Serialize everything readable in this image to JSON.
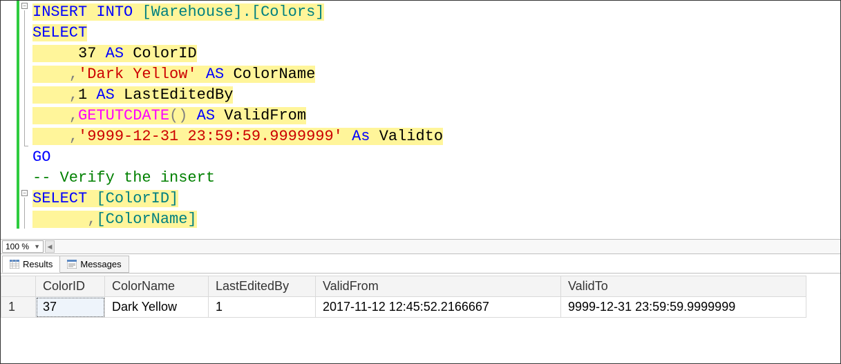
{
  "code": {
    "line1": {
      "insert_into": "INSERT INTO",
      "tbl": "[Warehouse].[Colors]"
    },
    "line2": {
      "select": "SELECT"
    },
    "line3": {
      "val": "37",
      "as": "AS",
      "alias": "ColorID"
    },
    "line4": {
      "comma": ",",
      "val": "'Dark Yellow'",
      "as": "AS",
      "alias": "ColorName"
    },
    "line5": {
      "comma": ",",
      "val": "1",
      "as": "AS",
      "alias": "LastEditedBy"
    },
    "line6": {
      "comma": ",",
      "func": "GETUTCDATE",
      "parens": "()",
      "as": "AS",
      "alias": "ValidFrom"
    },
    "line7": {
      "comma": ",",
      "val": "'9999-12-31 23:59:59.9999999'",
      "as": "As",
      "alias": "Validto"
    },
    "line8": {
      "go": "GO"
    },
    "line9": {
      "comment": "-- Verify the insert"
    },
    "line10": {
      "select": "SELECT",
      "col": "[ColorID]"
    },
    "line11": {
      "comma": ",",
      "col": "[ColorName]"
    }
  },
  "zoom": {
    "value": "100 %"
  },
  "tabs": {
    "results": "Results",
    "messages": "Messages"
  },
  "results": {
    "headers": {
      "rownum": "1",
      "colorid": "ColorID",
      "colorname": "ColorName",
      "lasteditedby": "LastEditedBy",
      "validfrom": "ValidFrom",
      "validto": "ValidTo"
    },
    "row1": {
      "colorid": "37",
      "colorname": "Dark Yellow",
      "lasteditedby": "1",
      "validfrom": "2017-11-12 12:45:52.2166667",
      "validto": "9999-12-31 23:59:59.9999999"
    }
  }
}
